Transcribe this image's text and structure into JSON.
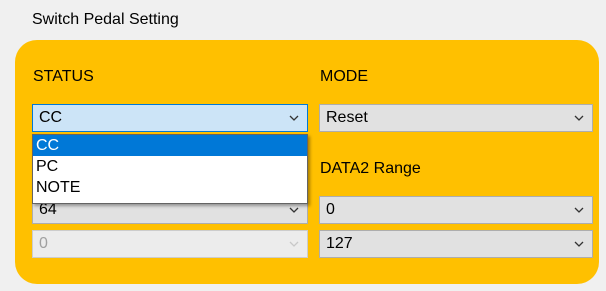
{
  "group": {
    "title": "Switch Pedal Setting"
  },
  "labels": {
    "status": "STATUS",
    "mode": "MODE",
    "data2_range": "DATA2 Range"
  },
  "combos": {
    "status": {
      "value": "CC"
    },
    "data1": {
      "value": "64"
    },
    "data1_max": {
      "value": "0"
    },
    "mode": {
      "value": "Reset"
    },
    "data2_min": {
      "value": "0"
    },
    "data2_max": {
      "value": "127"
    }
  },
  "dropdown": {
    "options": [
      "CC",
      "PC",
      "NOTE"
    ],
    "selected": "CC"
  },
  "colors": {
    "panel": "#ffc000",
    "focus_border": "#0078d7",
    "highlight": "#0078d7"
  },
  "icons": {
    "combo_arrow": "chevron-down-icon"
  }
}
